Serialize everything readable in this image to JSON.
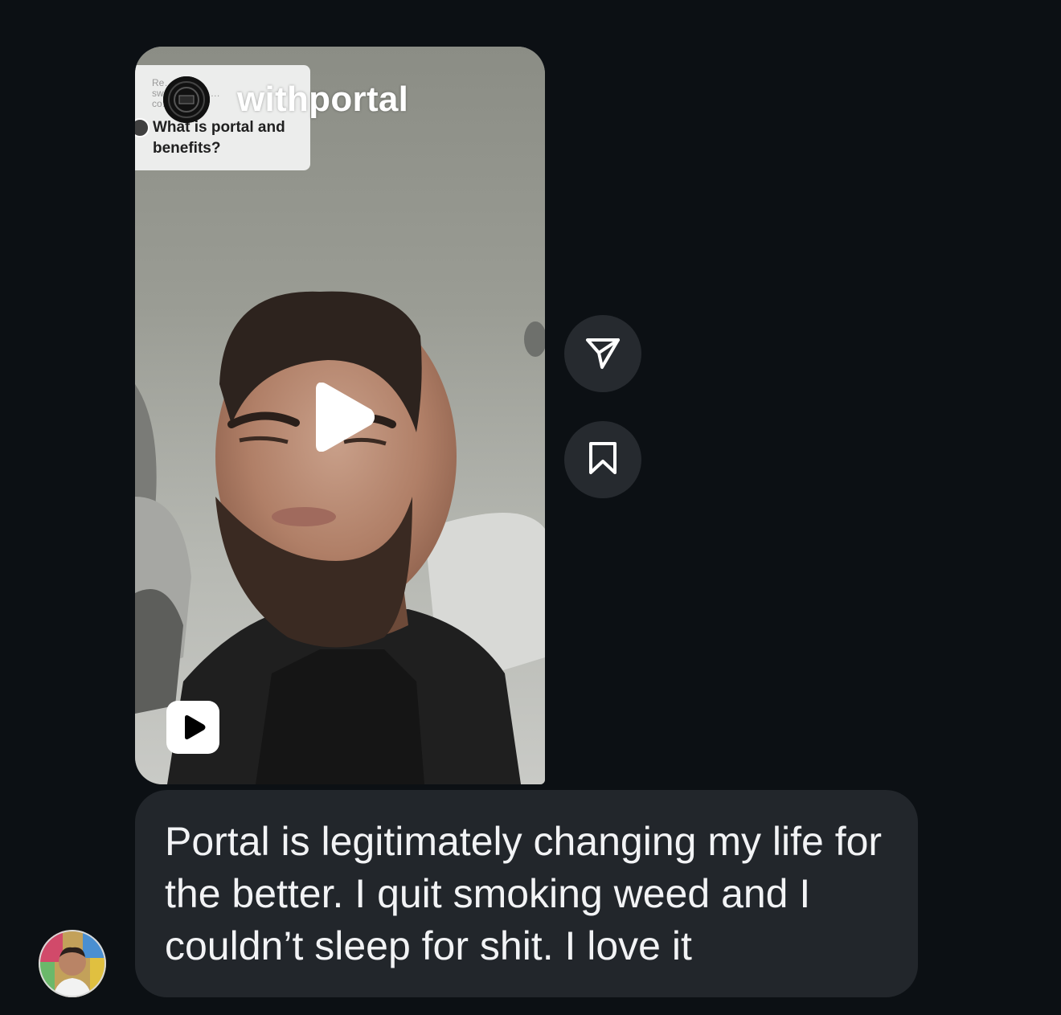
{
  "reel": {
    "account_name": "withportal",
    "reply_sticker": {
      "small_text": "Re…\nsw…  ngon  in  …\nco…",
      "question": "What is portal and benefits?"
    }
  },
  "icons": {
    "play": "play-icon",
    "reel_badge": "reels-icon",
    "share": "paper-plane-icon",
    "save": "bookmark-icon"
  },
  "message": {
    "text": "Portal is legitimately changing my life for the better. I quit smoking weed and I couldn’t sleep for shit. I love it"
  },
  "colors": {
    "background": "#0c1014",
    "bubble": "#22262b",
    "side_button": "#262a2f",
    "text": "#f2f3f5"
  }
}
